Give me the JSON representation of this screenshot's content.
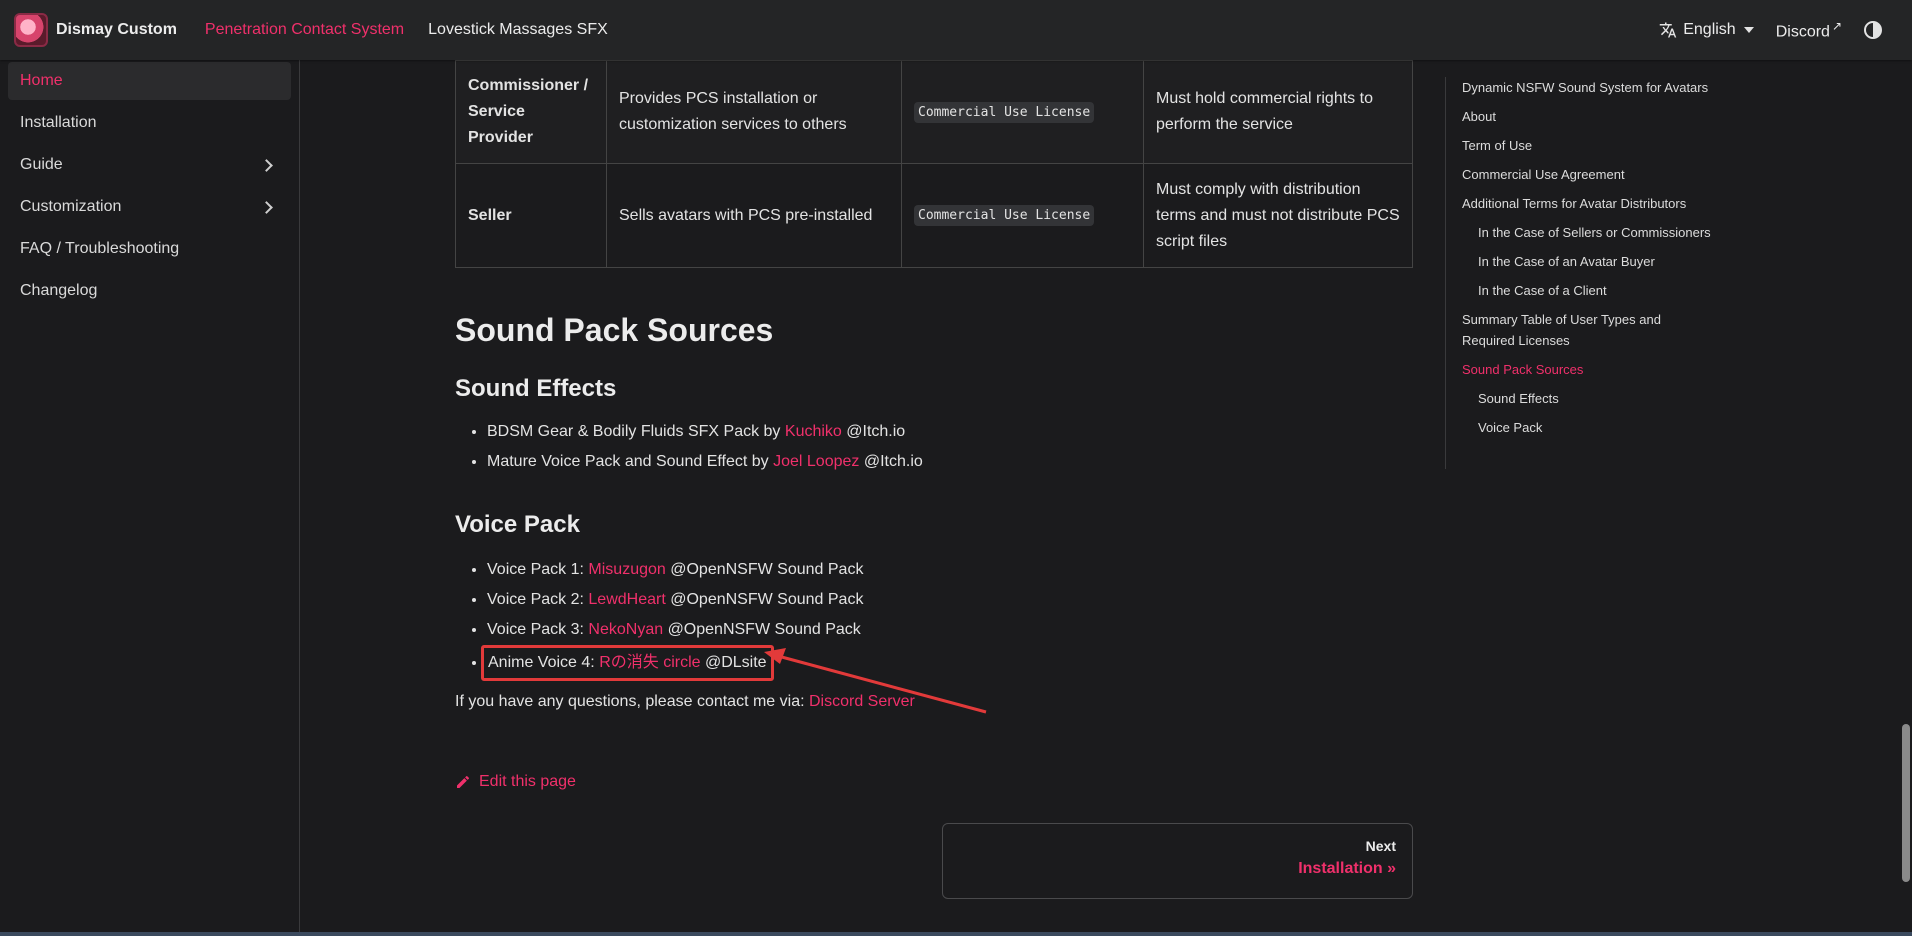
{
  "navbar": {
    "brand": "Dismay Custom",
    "links": [
      "Penetration Contact System",
      "Lovestick Massages SFX"
    ],
    "language": "English",
    "discord": "Discord"
  },
  "sidebar": {
    "items": [
      {
        "label": "Home"
      },
      {
        "label": "Installation"
      },
      {
        "label": "Guide"
      },
      {
        "label": "Customization"
      },
      {
        "label": "FAQ / Troubleshooting"
      },
      {
        "label": "Changelog"
      }
    ]
  },
  "table": {
    "rows": [
      {
        "role_line1": "Commissioner /",
        "role_line2": "Service Provider",
        "description": "Provides PCS installation or customization services to others",
        "license": "Commercial Use License",
        "note": "Must hold commercial rights to perform the service"
      },
      {
        "role_line1": "Seller",
        "role_line2": "",
        "description": "Sells avatars with PCS pre-installed",
        "license": "Commercial Use License",
        "note": "Must comply with distribution terms and must not distribute PCS script files"
      }
    ]
  },
  "content": {
    "section_title": "Sound Pack Sources",
    "sound_effects": {
      "title": "Sound Effects",
      "items": [
        {
          "prefix": "BDSM Gear & Bodily Fluids SFX Pack by",
          "link": "Kuchiko",
          "suffix": "@Itch.io"
        },
        {
          "prefix": "Mature Voice Pack and Sound Effect by",
          "link": "Joel Loopez",
          "suffix": "@Itch.io"
        }
      ]
    },
    "voice_pack": {
      "title": "Voice Pack",
      "items": [
        {
          "prefix": "Voice Pack 1:",
          "link": "Misuzugon",
          "suffix": "@OpenNSFW Sound Pack"
        },
        {
          "prefix": "Voice Pack 2:",
          "link": "LewdHeart",
          "suffix": "@OpenNSFW Sound Pack"
        },
        {
          "prefix": "Voice Pack 3:",
          "link": "NekoNyan",
          "suffix": "@OpenNSFW Sound Pack"
        },
        {
          "prefix": "Anime Voice 4:",
          "link": "Rの消失 circle",
          "suffix": "@DLsite"
        }
      ]
    },
    "contact_text": "If you have any questions, please contact me via:",
    "contact_link": "Discord Server",
    "edit_label": "Edit this page",
    "pager": {
      "sub": "Next",
      "title": "Installation »"
    }
  },
  "toc": {
    "items": [
      {
        "label": "Dynamic NSFW Sound System for Avatars",
        "indent": false
      },
      {
        "label": "About",
        "indent": false
      },
      {
        "label": "Term of Use",
        "indent": false
      },
      {
        "label": "Commercial Use Agreement",
        "indent": false
      },
      {
        "label": "Additional Terms for Avatar Distributors",
        "indent": false
      },
      {
        "label": "In the Case of Sellers or Commissioners",
        "indent": true
      },
      {
        "label": "In the Case of an Avatar Buyer",
        "indent": true
      },
      {
        "label": "In the Case of a Client",
        "indent": true
      },
      {
        "label": "Summary Table of User Types and Required Licenses",
        "indent": false
      },
      {
        "label": "Sound Pack Sources",
        "indent": false,
        "active": true
      },
      {
        "label": "Sound Effects",
        "indent": true
      },
      {
        "label": "Voice Pack",
        "indent": true
      }
    ]
  },
  "colors": {
    "accent": "#f0306b",
    "background": "#1b1b1d",
    "annotation": "#e23a3a"
  }
}
